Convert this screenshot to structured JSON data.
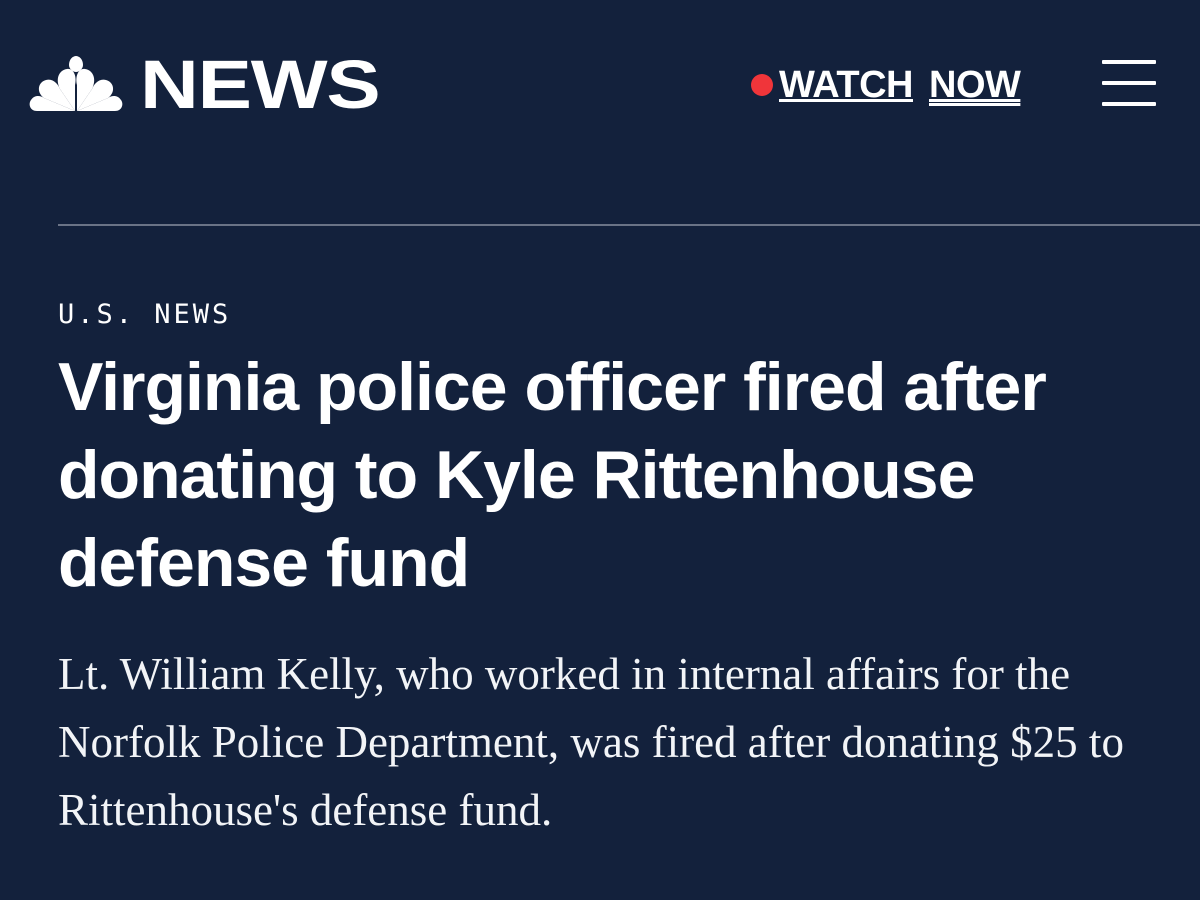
{
  "header": {
    "logo_text": "NEWS",
    "watch_label": "WATCH",
    "now_label": "NOW",
    "live_dot_color": "#f0353a",
    "peacock_icon": "peacock-logo-icon",
    "menu_icon": "hamburger-menu-icon"
  },
  "article": {
    "section": "U.S. NEWS",
    "headline": "Virginia police officer fired after donating to Kyle Rittenhouse defense fund",
    "dek": "Lt. William Kelly, who worked in internal affairs for the Norfolk Police Department, was fired after donating $25 to Rittenhouse's defense fund."
  },
  "colors": {
    "background": "#13213c",
    "text": "#ffffff",
    "divider": "#6a7386",
    "peacock_white": "#ffffff"
  }
}
